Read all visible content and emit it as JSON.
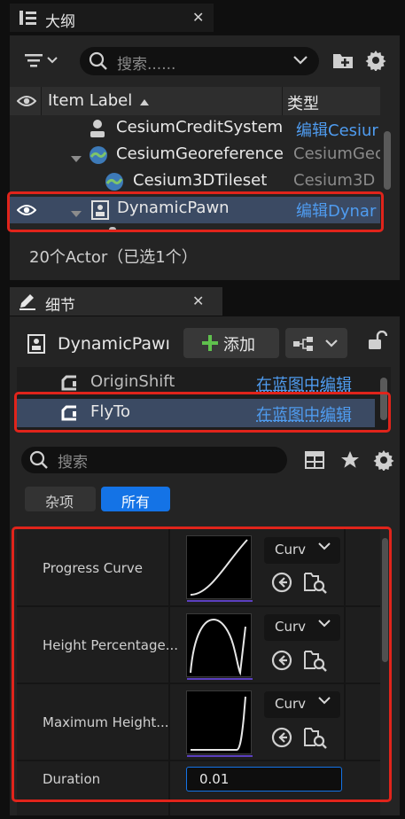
{
  "outliner": {
    "tab_title": "大纲",
    "search_placeholder": "搜索......",
    "col_label": "Item Label",
    "col_type": "类型",
    "rows": [
      {
        "label": "CesiumCreditSystemI",
        "type": "编辑Cesiur"
      },
      {
        "label": "CesiumGeoreference(",
        "type": "CesiumGec"
      },
      {
        "label": "Cesium3DTileset",
        "type": "Cesium3D"
      },
      {
        "label": "DynamicPawn",
        "type": "编辑Dynar"
      }
    ],
    "status": "20个Actor（已选1个）"
  },
  "details": {
    "tab_title": "细节",
    "actor_name": "DynamicPawı",
    "add_label": "添加",
    "components": [
      {
        "name": "OriginShift",
        "action": "在蓝图中编辑"
      },
      {
        "name": "FlyTo",
        "action": "在蓝图中编辑"
      }
    ],
    "search_placeholder": "搜索",
    "filter_misc": "杂项",
    "filter_all": "所有",
    "properties": [
      {
        "label": "Progress Curve",
        "dropdown": "Curv"
      },
      {
        "label": "Height Percentage...",
        "dropdown": "Curv"
      },
      {
        "label": "Maximum Height...",
        "dropdown": "Curv"
      }
    ],
    "duration_label": "Duration",
    "duration_value": "0.01"
  },
  "colors": {
    "selection": "#3b4a63",
    "highlight_box": "#e0241b",
    "accent_blue": "#1473e6",
    "link_blue": "#4f9cf0"
  }
}
